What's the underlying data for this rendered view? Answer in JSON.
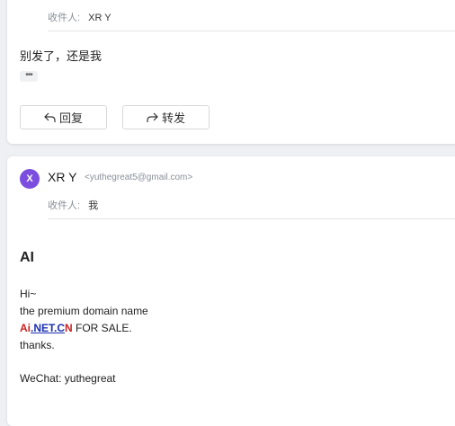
{
  "message1": {
    "recipient_label": "收件人:",
    "recipient_name": "XR Y",
    "body": "别发了，还是我",
    "ellipsis": "•••",
    "reply_label": "回复",
    "forward_label": "转发"
  },
  "message2": {
    "avatar_letter": "X",
    "avatar_color": "#7b4ee0",
    "sender_name": "XR Y",
    "sender_email": "<yuthegreat5@gmail.com>",
    "recipient_label": "收件人:",
    "recipient_name": "我",
    "heading": "AI",
    "greeting": "Hi~",
    "line2": "the premium domain name",
    "domain_ai": "Ai",
    "domain_net": ".NET.C",
    "domain_n": "N",
    "sale_text": " FOR SALE.",
    "thanks": "thanks.",
    "wechat": "WeChat: yuthegreat"
  }
}
